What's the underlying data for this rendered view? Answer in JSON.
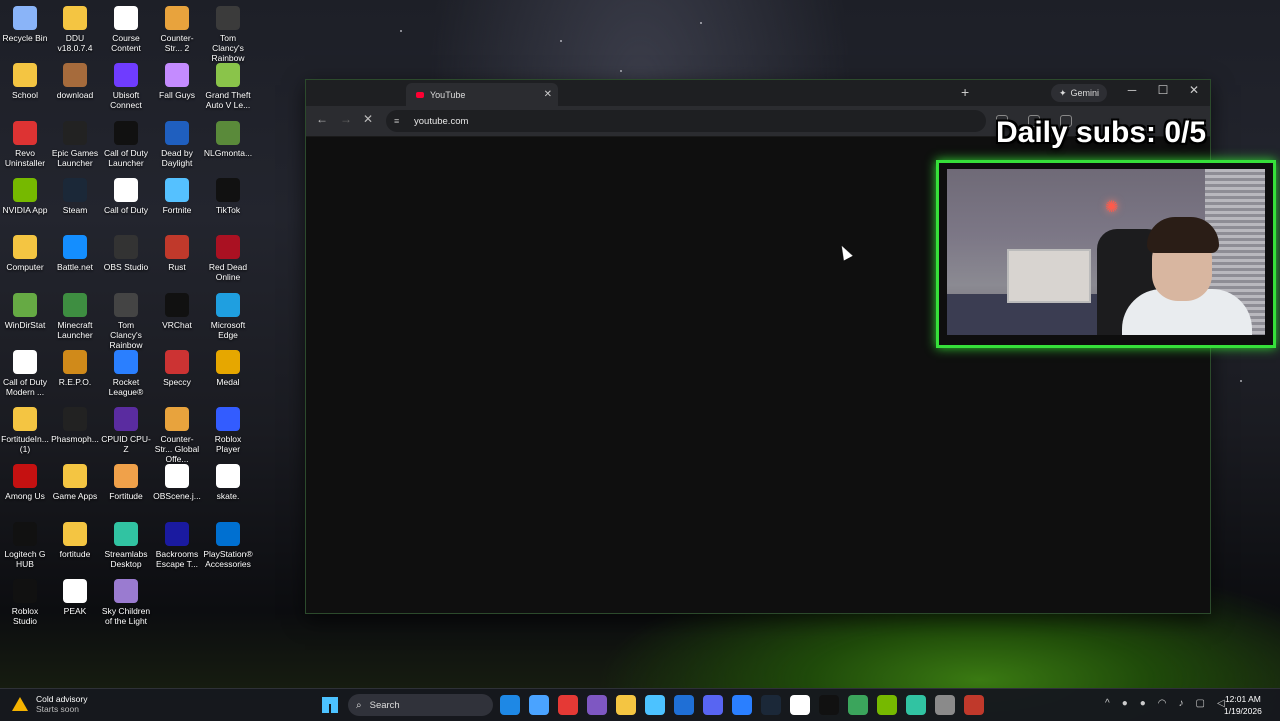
{
  "desktop_icons": [
    {
      "label": "Recycle Bin",
      "color": "#8ab4f8"
    },
    {
      "label": "DDU v18.0.7.4",
      "color": "#f4c542"
    },
    {
      "label": "Course Content",
      "color": "#ffffff"
    },
    {
      "label": "Counter-Str... 2",
      "color": "#e8a33d"
    },
    {
      "label": "Tom Clancy's Rainbow Si...",
      "color": "#3b3b3b"
    },
    {
      "label": "School",
      "color": "#f4c542"
    },
    {
      "label": "download",
      "color": "#a66b3c"
    },
    {
      "label": "Ubisoft Connect",
      "color": "#6f3cff"
    },
    {
      "label": "Fall Guys",
      "color": "#c48bff"
    },
    {
      "label": "Grand Theft Auto V Le...",
      "color": "#8ac44a"
    },
    {
      "label": "Revo Uninstaller",
      "color": "#d33"
    },
    {
      "label": "Epic Games Launcher",
      "color": "#222"
    },
    {
      "label": "Call of Duty Launcher",
      "color": "#111"
    },
    {
      "label": "Dead by Daylight",
      "color": "#1f5fbf"
    },
    {
      "label": "NLGmonta...",
      "color": "#5a8a3a"
    },
    {
      "label": "NVIDIA App",
      "color": "#76b900"
    },
    {
      "label": "Steam",
      "color": "#1b2838"
    },
    {
      "label": "Call of Duty",
      "color": "#ffffff"
    },
    {
      "label": "Fortnite",
      "color": "#55c1ff"
    },
    {
      "label": "TikTok",
      "color": "#111"
    },
    {
      "label": "Computer",
      "color": "#f4c542"
    },
    {
      "label": "Battle.net",
      "color": "#148eff"
    },
    {
      "label": "OBS Studio",
      "color": "#333"
    },
    {
      "label": "Rust",
      "color": "#c0392b"
    },
    {
      "label": "Red Dead Online",
      "color": "#a12"
    },
    {
      "label": "WinDirStat",
      "color": "#6a4"
    },
    {
      "label": "Minecraft Launcher",
      "color": "#3e8e41"
    },
    {
      "label": "Tom Clancy's Rainbow Si...",
      "color": "#444"
    },
    {
      "label": "VRChat",
      "color": "#111"
    },
    {
      "label": "Microsoft Edge",
      "color": "#1f9fe0"
    },
    {
      "label": "Call of Duty Modern ...",
      "color": "#ffffff"
    },
    {
      "label": "R.E.P.O.",
      "color": "#d08a1a"
    },
    {
      "label": "Rocket League®",
      "color": "#2a7fff"
    },
    {
      "label": "Speccy",
      "color": "#c33"
    },
    {
      "label": "Medal",
      "color": "#e6a700"
    },
    {
      "label": "FortitudeIn... (1)",
      "color": "#f4c542"
    },
    {
      "label": "Phasmoph...",
      "color": "#222"
    },
    {
      "label": "CPUID CPU-Z",
      "color": "#5a2ca0"
    },
    {
      "label": "Counter-Str... Global Offe...",
      "color": "#e8a33d"
    },
    {
      "label": "Roblox Player",
      "color": "#335cff"
    },
    {
      "label": "Among Us",
      "color": "#c51111"
    },
    {
      "label": "Game Apps",
      "color": "#f4c542"
    },
    {
      "label": "Fortitude",
      "color": "#f0a14a"
    },
    {
      "label": "OBScene.j...",
      "color": "#ffffff"
    },
    {
      "label": "skate.",
      "color": "#ffffff"
    },
    {
      "label": "Logitech G HUB",
      "color": "#111"
    },
    {
      "label": "fortitude",
      "color": "#f4c542"
    },
    {
      "label": "Streamlabs Desktop",
      "color": "#31c3a2"
    },
    {
      "label": "Backrooms Escape T...",
      "color": "#1a1aa0"
    },
    {
      "label": "PlayStation® Accessories",
      "color": "#0070d1"
    },
    {
      "label": "Roblox Studio",
      "color": "#111"
    },
    {
      "label": "PEAK",
      "color": "#ffffff"
    },
    {
      "label": "Sky Children of the Light",
      "color": "#9a7bd0"
    }
  ],
  "browser": {
    "tab_title": "YouTube",
    "gemini_label": "Gemini",
    "url": "youtube.com"
  },
  "overlay": {
    "daily_subs": "Daily subs: 0/5"
  },
  "taskbar": {
    "weather_title": "Cold advisory",
    "weather_sub": "Starts soon",
    "search_label": "Search",
    "app_colors": [
      "#1e88e5",
      "#4aa3ff",
      "#e53935",
      "#7e57c2",
      "#f4c542",
      "#4cc2ff",
      "#1f6fd6",
      "#5865f2",
      "#2a7fff",
      "#1b2838",
      "#ffffff",
      "#111",
      "#3ba55c",
      "#76b900",
      "#31c3a2",
      "#8a8a8a",
      "#c0392b"
    ],
    "time": "12:01 AM",
    "date": "1/19/2026"
  }
}
